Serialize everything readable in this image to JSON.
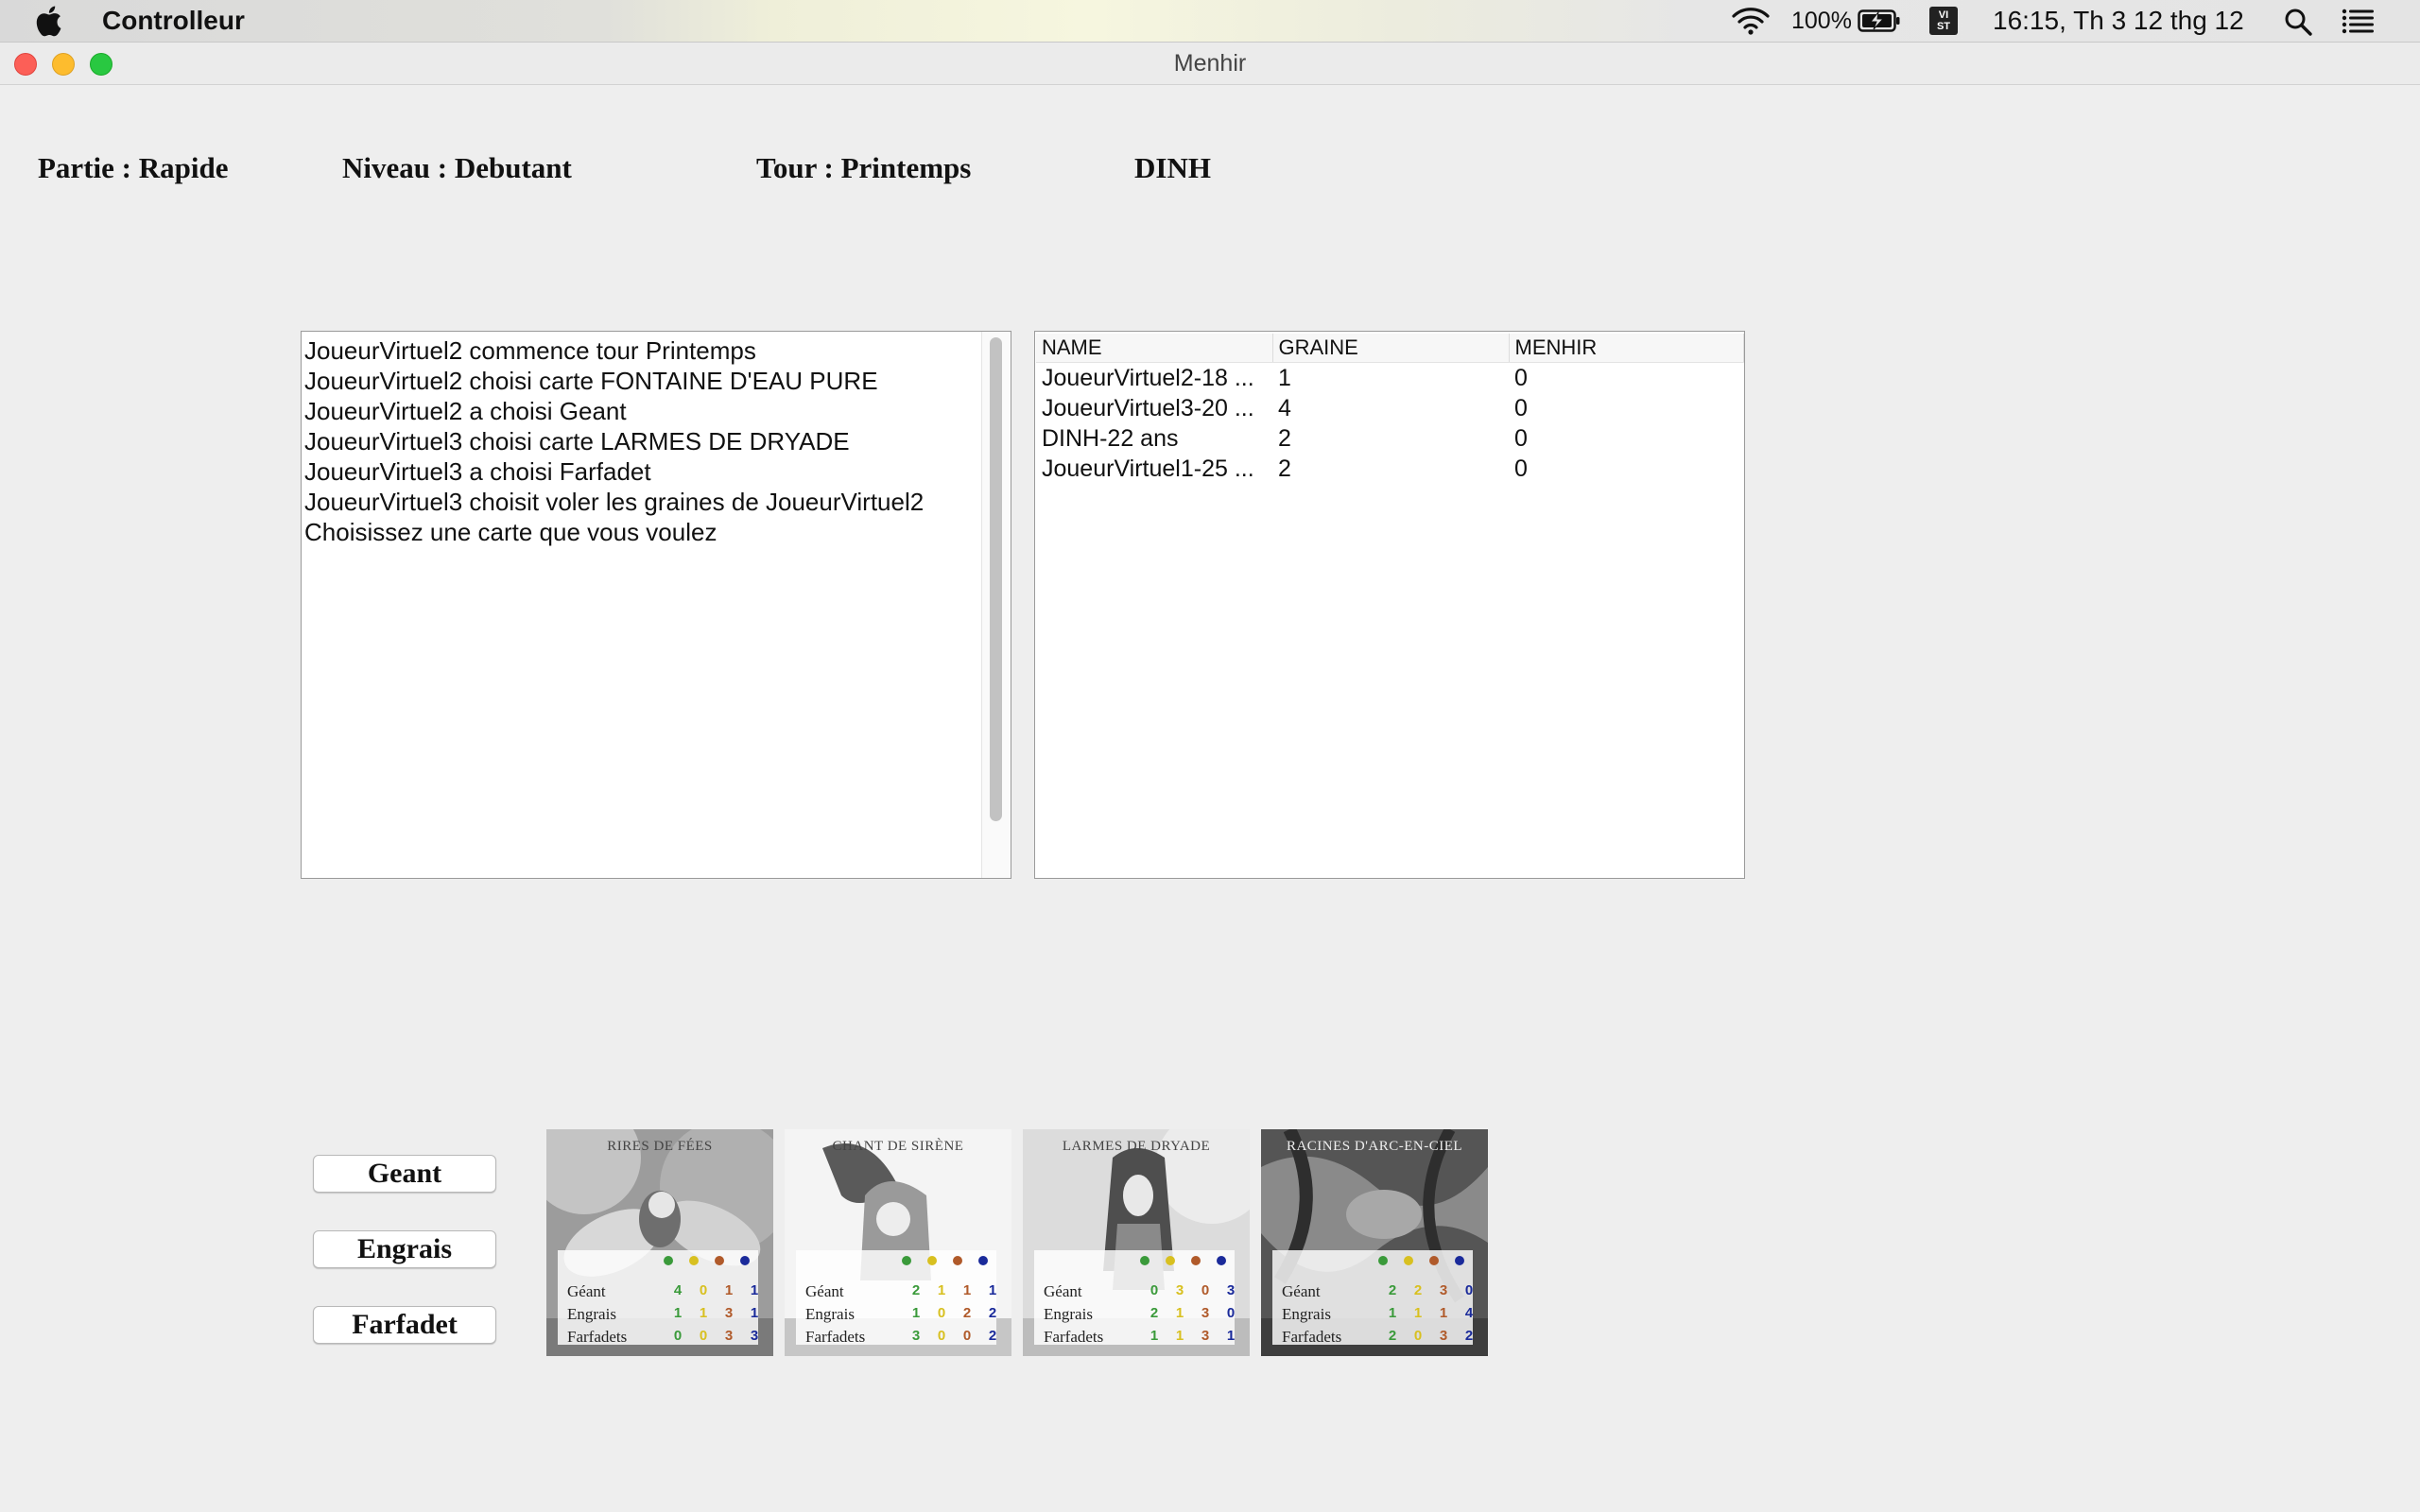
{
  "menubar": {
    "app_name": "Controlleur",
    "battery_percent": "100%",
    "input_source": "VI\nST",
    "clock": "16:15, Th 3 12 thg 12"
  },
  "window": {
    "title": "Menhir"
  },
  "info": {
    "partie": "Partie : Rapide",
    "niveau": "Niveau : Debutant",
    "tour": "Tour : Printemps",
    "player": "DINH"
  },
  "log": [
    "JoueurVirtuel2 commence tour Printemps",
    "JoueurVirtuel2 choisi carte FONTAINE D'EAU PURE",
    "JoueurVirtuel2 a choisi Geant",
    "JoueurVirtuel3 choisi carte LARMES DE DRYADE",
    "JoueurVirtuel3 a choisi Farfadet",
    "JoueurVirtuel3 choisit voler les graines de JoueurVirtuel2",
    "Choisissez une carte que vous voulez"
  ],
  "table": {
    "headers": [
      "NAME",
      "GRAINE",
      "MENHIR"
    ],
    "rows": [
      [
        "JoueurVirtuel2-18 ...",
        "1",
        "0"
      ],
      [
        "JoueurVirtuel3-20 ...",
        "4",
        "0"
      ],
      [
        "DINH-22 ans",
        "2",
        "0"
      ],
      [
        "JoueurVirtuel1-25 ...",
        "2",
        "0"
      ]
    ]
  },
  "buttons": {
    "geant": "Geant",
    "engrais": "Engrais",
    "farfadet": "Farfadet"
  },
  "season_colors": [
    "#3a9a3a",
    "#d8c020",
    "#b05a2a",
    "#1a2a9a"
  ],
  "cards": [
    {
      "title": "RIRES DE FÉES",
      "labels": [
        "Géant",
        "Engrais",
        "Farfadets"
      ],
      "rows": [
        [
          "4",
          "0",
          "1",
          "1"
        ],
        [
          "1",
          "1",
          "3",
          "1"
        ],
        [
          "0",
          "0",
          "3",
          "3"
        ]
      ]
    },
    {
      "title": "CHANT DE SIRÈNE",
      "labels": [
        "Géant",
        "Engrais",
        "Farfadets"
      ],
      "rows": [
        [
          "2",
          "1",
          "1",
          "1"
        ],
        [
          "1",
          "0",
          "2",
          "2"
        ],
        [
          "3",
          "0",
          "0",
          "2"
        ]
      ]
    },
    {
      "title": "LARMES DE DRYADE",
      "labels": [
        "Géant",
        "Engrais",
        "Farfadets"
      ],
      "rows": [
        [
          "0",
          "3",
          "0",
          "3"
        ],
        [
          "2",
          "1",
          "3",
          "0"
        ],
        [
          "1",
          "1",
          "3",
          "1"
        ]
      ]
    },
    {
      "title": "RACINES D'ARC-EN-CIEL",
      "labels": [
        "Géant",
        "Engrais",
        "Farfadets"
      ],
      "rows": [
        [
          "2",
          "2",
          "3",
          "0"
        ],
        [
          "1",
          "1",
          "1",
          "4"
        ],
        [
          "2",
          "0",
          "3",
          "2"
        ]
      ]
    }
  ]
}
